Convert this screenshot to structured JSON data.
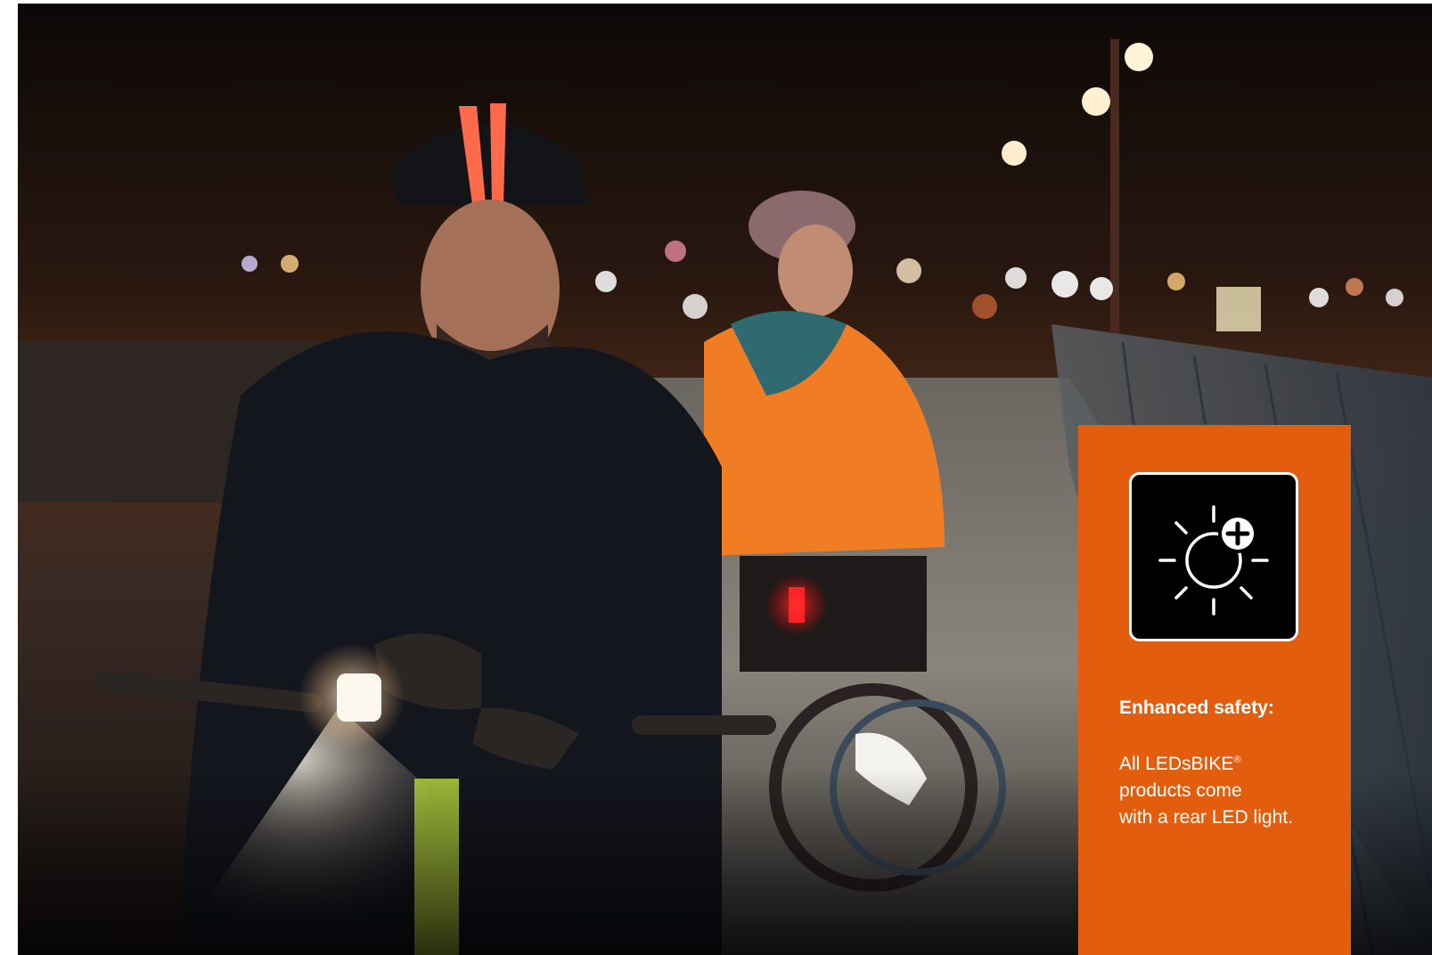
{
  "info_panel": {
    "heading": "Enhanced safety:",
    "body_line_1_prefix": "All LEDsBIKE",
    "body_line_1_mark": "®",
    "body_line_2": "products come",
    "body_line_3": "with a rear LED light.",
    "icon": "sun-plus-icon"
  },
  "colors": {
    "panel_background": "#e35d0f",
    "icon_box_background": "#000000",
    "text": "#ffffff"
  }
}
